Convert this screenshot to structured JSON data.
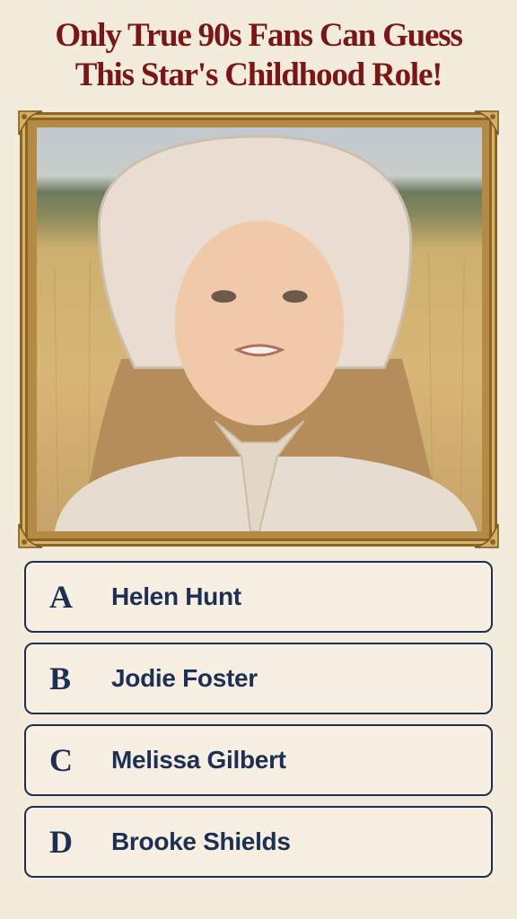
{
  "title": {
    "line1": "Only True 90s Fans Can Guess",
    "line2": "This Star's Childhood Role!"
  },
  "photo": {
    "subject": "girl-in-bonnet-photo"
  },
  "options": [
    {
      "letter": "A",
      "text": "Helen Hunt"
    },
    {
      "letter": "B",
      "text": "Jodie Foster"
    },
    {
      "letter": "C",
      "text": "Melissa Gilbert"
    },
    {
      "letter": "D",
      "text": "Brooke Shields"
    }
  ],
  "colors": {
    "background": "#f3ebdc",
    "title": "#7a1616",
    "option_border": "#1d2f55",
    "frame_gold": "#b58a45"
  }
}
